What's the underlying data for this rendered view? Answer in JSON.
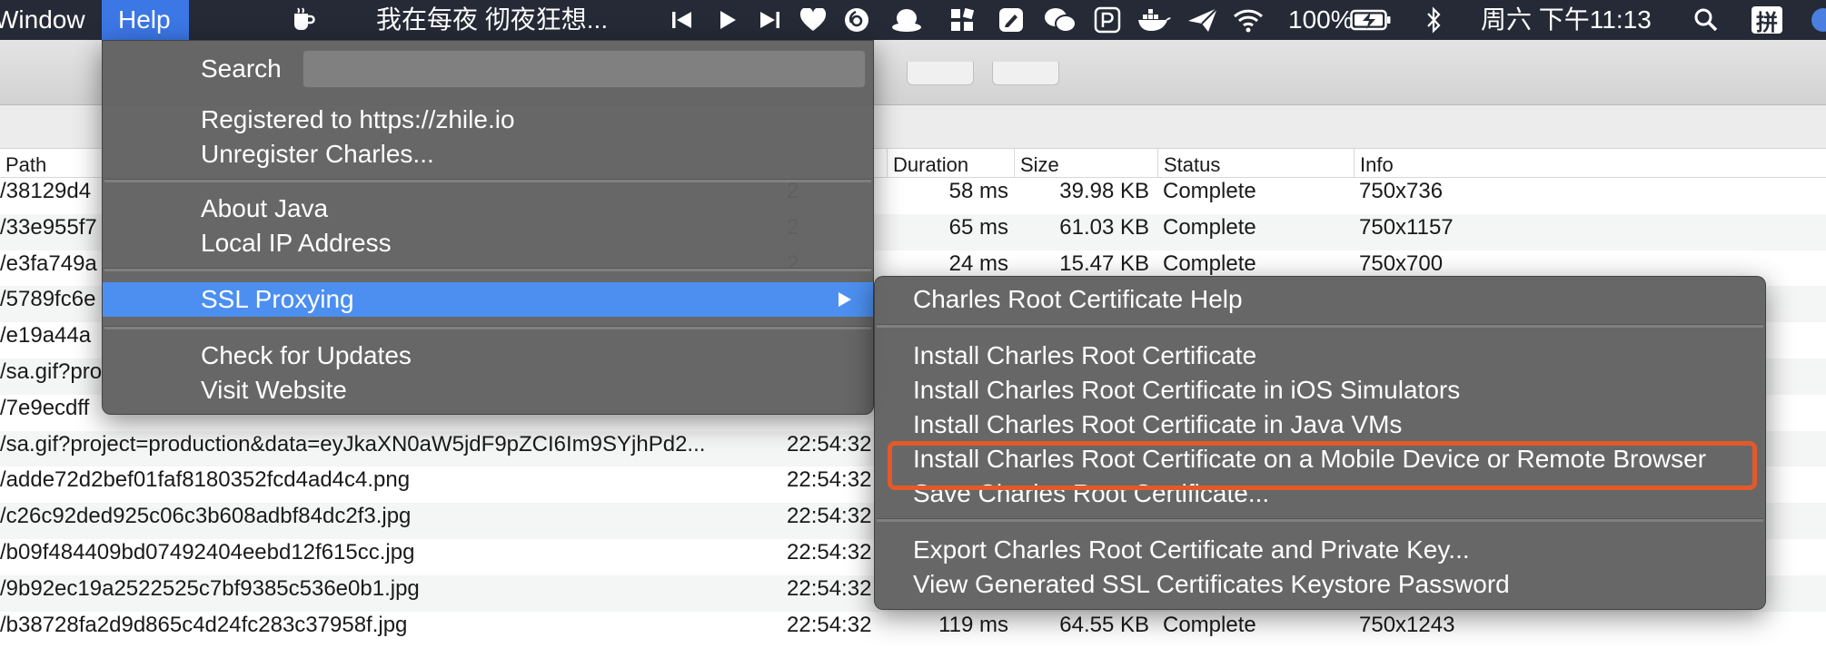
{
  "menubar": {
    "items": [
      "Window",
      "Help"
    ],
    "now_playing": "我在每夜 彻夜狂想...",
    "battery": "100%",
    "clock": "周六 下午11:13",
    "input_method": "拼"
  },
  "help_menu": {
    "search_label": "Search",
    "search_value": "",
    "items": [
      "Registered to https://zhile.io",
      "Unregister Charles...",
      "About Java",
      "Local IP Address",
      "SSL Proxying",
      "Check for Updates",
      "Visit Website"
    ]
  },
  "ssl_menu": {
    "items": [
      "Charles Root Certificate Help",
      "Install Charles Root Certificate",
      "Install Charles Root Certificate in iOS Simulators",
      "Install Charles Root Certificate in Java VMs",
      "Install Charles Root Certificate on a Mobile Device or Remote Browser",
      "Save Charles Root Certificate...",
      "Export Charles Root Certificate and Private Key...",
      "View Generated SSL Certificates Keystore Password"
    ]
  },
  "table": {
    "headers": {
      "path": "Path",
      "duration": "Duration",
      "size": "Size",
      "status": "Status",
      "info": "Info"
    },
    "rows": [
      {
        "path": "/38129d4",
        "time": "2",
        "duration": "58 ms",
        "size": "39.98 KB",
        "status": "Complete",
        "info": "750x736"
      },
      {
        "path": "/33e955f7",
        "time": "2",
        "duration": "65 ms",
        "size": "61.03 KB",
        "status": "Complete",
        "info": "750x1157"
      },
      {
        "path": "/e3fa749a",
        "time": "2",
        "duration": "24 ms",
        "size": "15.47 KB",
        "status": "Complete",
        "info": "750x700"
      },
      {
        "path": "/5789fc6e",
        "time": "",
        "duration": "",
        "size": "",
        "status": "",
        "info": ""
      },
      {
        "path": "/e19a44a",
        "time": "",
        "duration": "",
        "size": "",
        "status": "",
        "info": ""
      },
      {
        "path": "/sa.gif?pro",
        "time": "",
        "duration": "",
        "size": "",
        "status": "",
        "info": ""
      },
      {
        "path": "/7e9ecdff",
        "time": "",
        "duration": "",
        "size": "",
        "status": "",
        "info": ""
      },
      {
        "path": "/sa.gif?project=production&data=eyJkaXN0aW5jdF9pZCI6Im9SYjhPd2...",
        "time": "22:54:32",
        "duration": "",
        "size": "",
        "status": "",
        "info": ""
      },
      {
        "path": "/adde72d2bef01faf8180352fcd4ad4c4.png",
        "time": "22:54:32",
        "duration": "",
        "size": "",
        "status": "",
        "info": ""
      },
      {
        "path": "/c26c92ded925c06c3b608adbf84dc2f3.jpg",
        "time": "22:54:32",
        "duration": "",
        "size": "",
        "status": "",
        "info": ""
      },
      {
        "path": "/b09f484409bd07492404eebd12f615cc.jpg",
        "time": "22:54:32",
        "duration": "",
        "size": "",
        "status": "",
        "info": ""
      },
      {
        "path": "/9b92ec19a2522525c7bf9385c536e0b1.jpg",
        "time": "22:54:32",
        "duration": "",
        "size": "",
        "status": "",
        "info": ""
      },
      {
        "path": "/b38728fa2d9d865c4d24fc283c37958f.jpg",
        "time": "22:54:32",
        "duration": "119 ms",
        "size": "64.55 KB",
        "status": "Complete",
        "info": "750x1243"
      }
    ]
  },
  "colors": {
    "menubar_bg": "#252a36",
    "selection": "#4c8ff0",
    "menu_bg": "#626262",
    "highlight_box": "#e25a2a"
  },
  "icons": [
    "coffee-icon",
    "previous-track-icon",
    "play-icon",
    "next-track-icon",
    "heart-icon",
    "netease-music-icon",
    "qq-icon",
    "app-grid-icon",
    "note-icon",
    "wechat-icon",
    "app-p-icon",
    "docker-icon",
    "paper-plane-icon",
    "wifi-icon",
    "battery-charging-icon",
    "bluetooth-icon",
    "search-icon",
    "input-method-icon",
    "siri-icon"
  ]
}
